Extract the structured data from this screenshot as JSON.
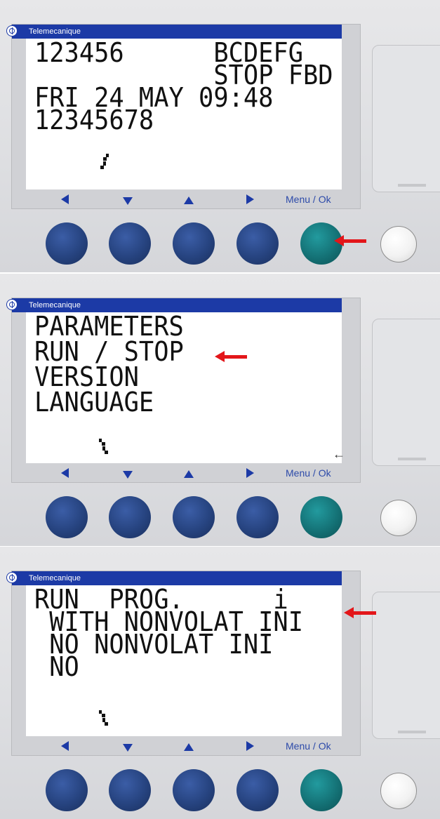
{
  "brand": "Telemecanique",
  "keys": {
    "menu_ok": "Menu / Ok"
  },
  "colors": {
    "titlebar": "#1c3aa6",
    "ok_button": "#136e72",
    "nav_button": "#26437f",
    "pointer_arrow": "#e3161a"
  },
  "panels": [
    {
      "lines": [
        "123456      BCDEFG",
        "            STOP FBD",
        "FRI 24 MAY 09:48",
        "12345678"
      ]
    },
    {
      "lines": [
        "PARAMETERS",
        "RUN / STOP",
        "VERSION",
        "LANGUAGE"
      ],
      "scroll_indicator": "←"
    },
    {
      "lines": [
        "RUN  PROG.      i",
        " WITH NONVOLAT INI",
        " NO NONVOLAT INI",
        " NO"
      ]
    }
  ]
}
